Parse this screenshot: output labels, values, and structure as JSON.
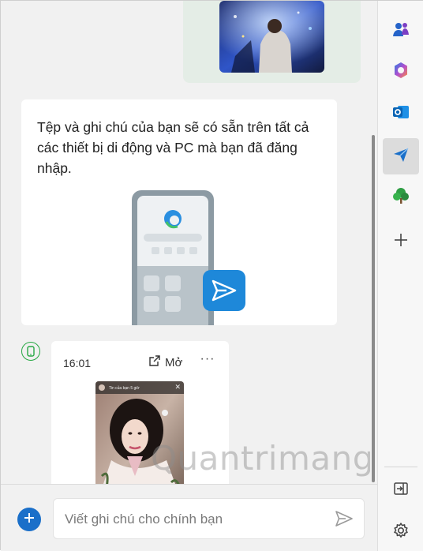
{
  "chat": {
    "info_message": "Tệp và ghi chú của bạn sẽ có sẵn trên tất cả các thiết bị di động và PC mà bạn đã đăng nhập.",
    "file_card": {
      "time": "16:01",
      "open_label": "Mở",
      "more_label": "···",
      "thumb_caption": "Tin của bạn  5 giờ"
    },
    "watermark": "Quantrimang"
  },
  "composer": {
    "placeholder": "Viết ghi chú cho chính bạn"
  },
  "rail": {
    "items": [
      "people-icon",
      "copilot-icon",
      "outlook-icon",
      "drop-icon",
      "tree-icon",
      "add-icon"
    ],
    "bottom": [
      "sidebar-toggle-icon",
      "settings-icon"
    ]
  },
  "colors": {
    "accent": "#1a6fc9",
    "sent_bubble": "#e4ede6",
    "device_green": "#27a844"
  }
}
